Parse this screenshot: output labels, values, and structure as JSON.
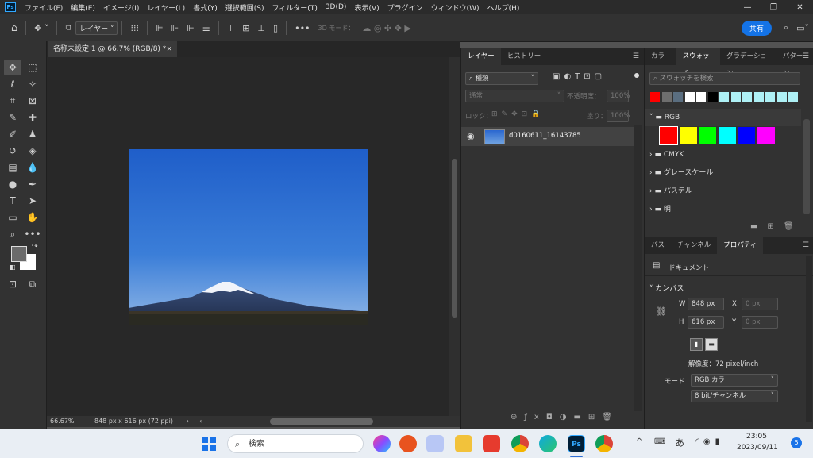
{
  "menubar": {
    "logo": "Ps",
    "items": [
      "ファイル(F)",
      "編集(E)",
      "イメージ(I)",
      "レイヤー(L)",
      "書式(Y)",
      "選択範囲(S)",
      "フィルター(T)",
      "3D(D)",
      "表示(V)",
      "プラグイン",
      "ウィンドウ(W)",
      "ヘルプ(H)"
    ],
    "minimize": "—",
    "restore": "❐",
    "close": "✕"
  },
  "optbar": {
    "layer_select": "レイヤー",
    "mode_label": "3D モード：",
    "share": "共有"
  },
  "document": {
    "tab_title": "名称未設定 1 @ 66.7% (RGB/8) *",
    "zoom": "66.67%",
    "info": "848 px x 616 px (72 ppi)"
  },
  "layers_panel": {
    "tabs": [
      "レイヤー",
      "ヒストリー"
    ],
    "filter_kind": "種類",
    "blend_mode": "通常",
    "opacity_label": "不透明度：",
    "opacity_value": "100%",
    "lock_label": "ロック：",
    "fill_label": "塗り：",
    "fill_value": "100%",
    "layer_name": "d0160611_16143785"
  },
  "swatches_panel": {
    "tabs": [
      "カラー",
      "スウォッチ",
      "グラデーション",
      "パターン"
    ],
    "search_placeholder": "スウォッチを検索",
    "recent_colors": [
      "#ff0000",
      "#6e6e6e",
      "#5a6e80",
      "#ffffff",
      "#ffffff",
      "#000000",
      "#aef0f5",
      "#aef0f5",
      "#aef0f5",
      "#aef0f5",
      "#aef0f5",
      "#aef0f5",
      "#aef0f5"
    ],
    "rgb_group": "RGB",
    "rgb_colors": [
      "#ff0000",
      "#ffff00",
      "#00ff00",
      "#00ffff",
      "#0000ff",
      "#ff00ff"
    ],
    "groups": [
      "CMYK",
      "グレースケール",
      "パステル",
      "明"
    ]
  },
  "properties_panel": {
    "tabs": [
      "パス",
      "チャンネル",
      "プロパティ"
    ],
    "doc_label": "ドキュメント",
    "canvas_section": "カンバス",
    "w_label": "W",
    "w_value": "848 px",
    "h_label": "H",
    "h_value": "616 px",
    "x_label": "X",
    "x_placeholder": "0 px",
    "y_label": "Y",
    "y_placeholder": "0 px",
    "resolution": "解像度：72 pixel/inch",
    "mode_label": "モード",
    "mode_value": "RGB カラー",
    "depth_value": "8 bit/チャンネル"
  },
  "taskbar": {
    "search_placeholder": "検索",
    "ime": "あ",
    "time": "23:05",
    "date": "2023/09/11",
    "notifications": "5"
  }
}
